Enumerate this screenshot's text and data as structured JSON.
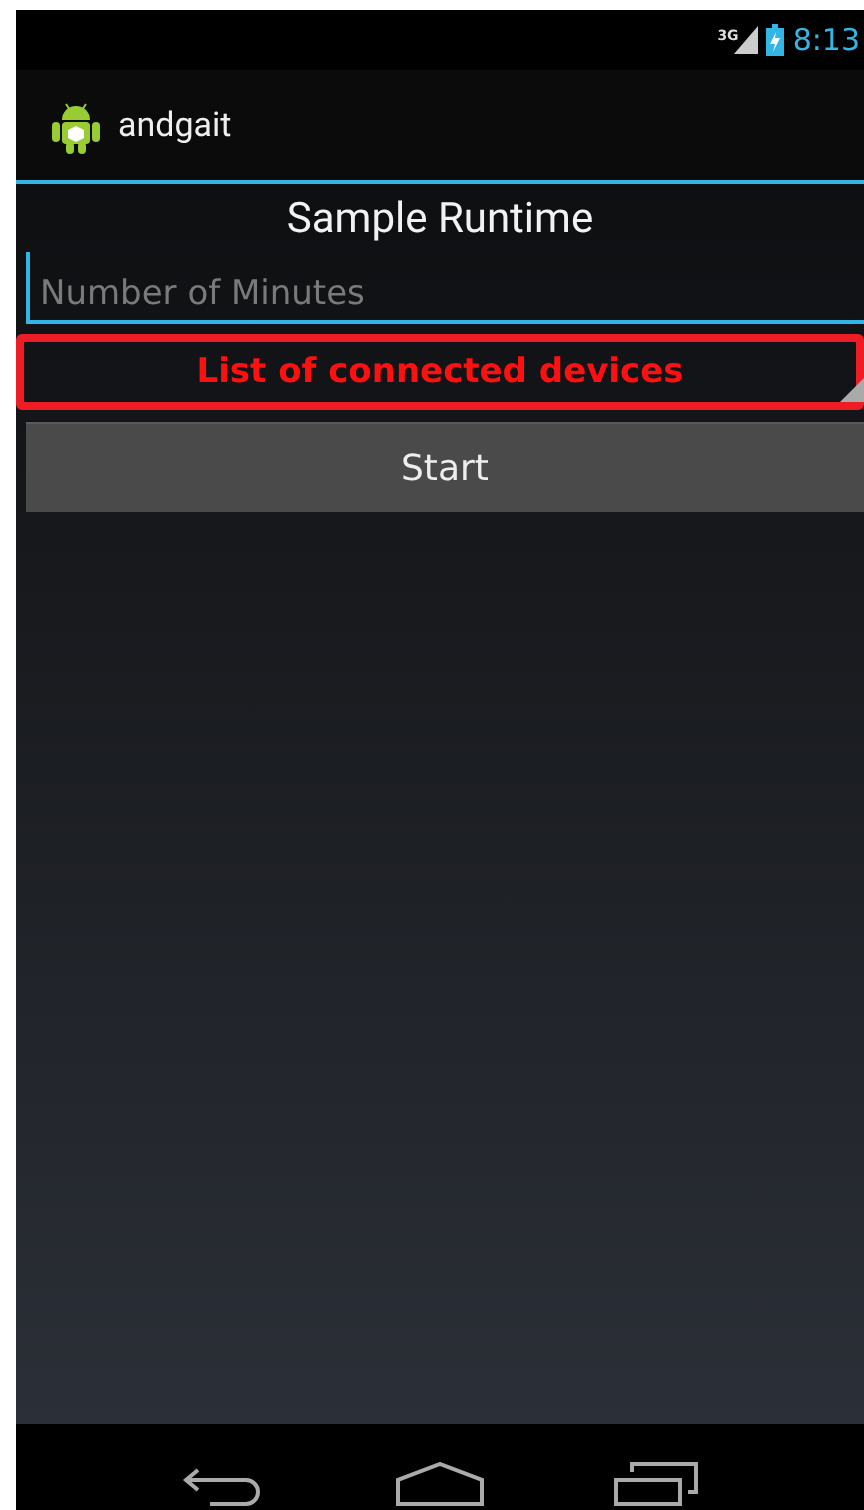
{
  "status_bar": {
    "network": "3G",
    "time": "8:13"
  },
  "action_bar": {
    "title": "andgait"
  },
  "form": {
    "heading": "Sample Runtime",
    "minutes_field": {
      "placeholder": "Number of Minutes",
      "focused": true
    },
    "device_spinner": {
      "label": "List of connected devices",
      "highlighted": true
    },
    "start_button": {
      "label": "Start"
    }
  }
}
